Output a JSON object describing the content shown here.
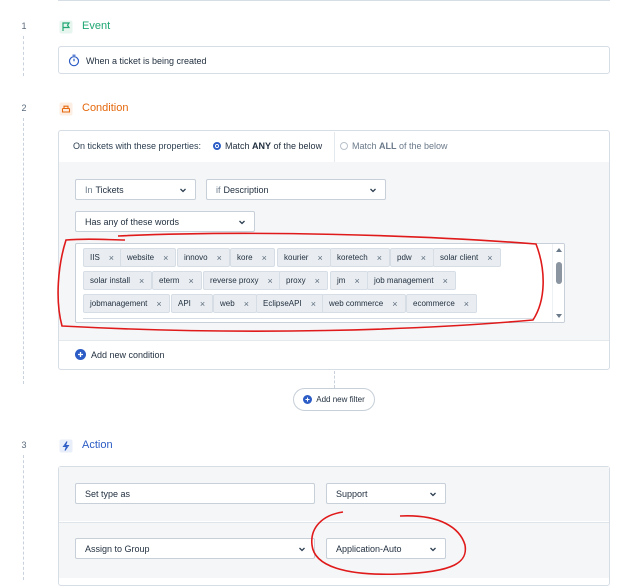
{
  "steps": [
    {
      "num": "1",
      "title": "Event",
      "color": "#1ea672"
    },
    {
      "num": "2",
      "title": "Condition",
      "color": "#e5680d"
    },
    {
      "num": "3",
      "title": "Action",
      "color": "#2c5cc5"
    }
  ],
  "event": {
    "trigger_text": "When a ticket is being created"
  },
  "condition": {
    "match_prefix": "On tickets with these properties:",
    "match_any": {
      "pre": "Match ",
      "strong": "ANY",
      "post": " of the below"
    },
    "match_all": {
      "pre": "Match ",
      "strong": "ALL",
      "post": " of the below"
    },
    "selected_match": "any",
    "in_select": {
      "prefix": "In",
      "value": "Tickets"
    },
    "if_select": {
      "prefix": "if",
      "value": "Description"
    },
    "operator": "Has any of these words",
    "tags": [
      "IIS",
      "website",
      "innovo",
      "kore",
      "kourier",
      "koretech",
      "pdw",
      "solar client",
      "solar install",
      "eterm",
      "reverse proxy",
      "proxy",
      "jm",
      "job management",
      "jobmanagement",
      "API",
      "web",
      "EclipseAPI",
      "web commerce",
      "ecommerce"
    ],
    "add_condition": "Add new condition",
    "add_filter": "Add new filter"
  },
  "action": {
    "rows": [
      {
        "field": "Set type as",
        "value": "Support"
      },
      {
        "field": "Assign to Group",
        "value": "Application-Auto"
      }
    ]
  },
  "colors": {
    "accent": "#2c5cc5",
    "annotation": "#e01a1a"
  }
}
